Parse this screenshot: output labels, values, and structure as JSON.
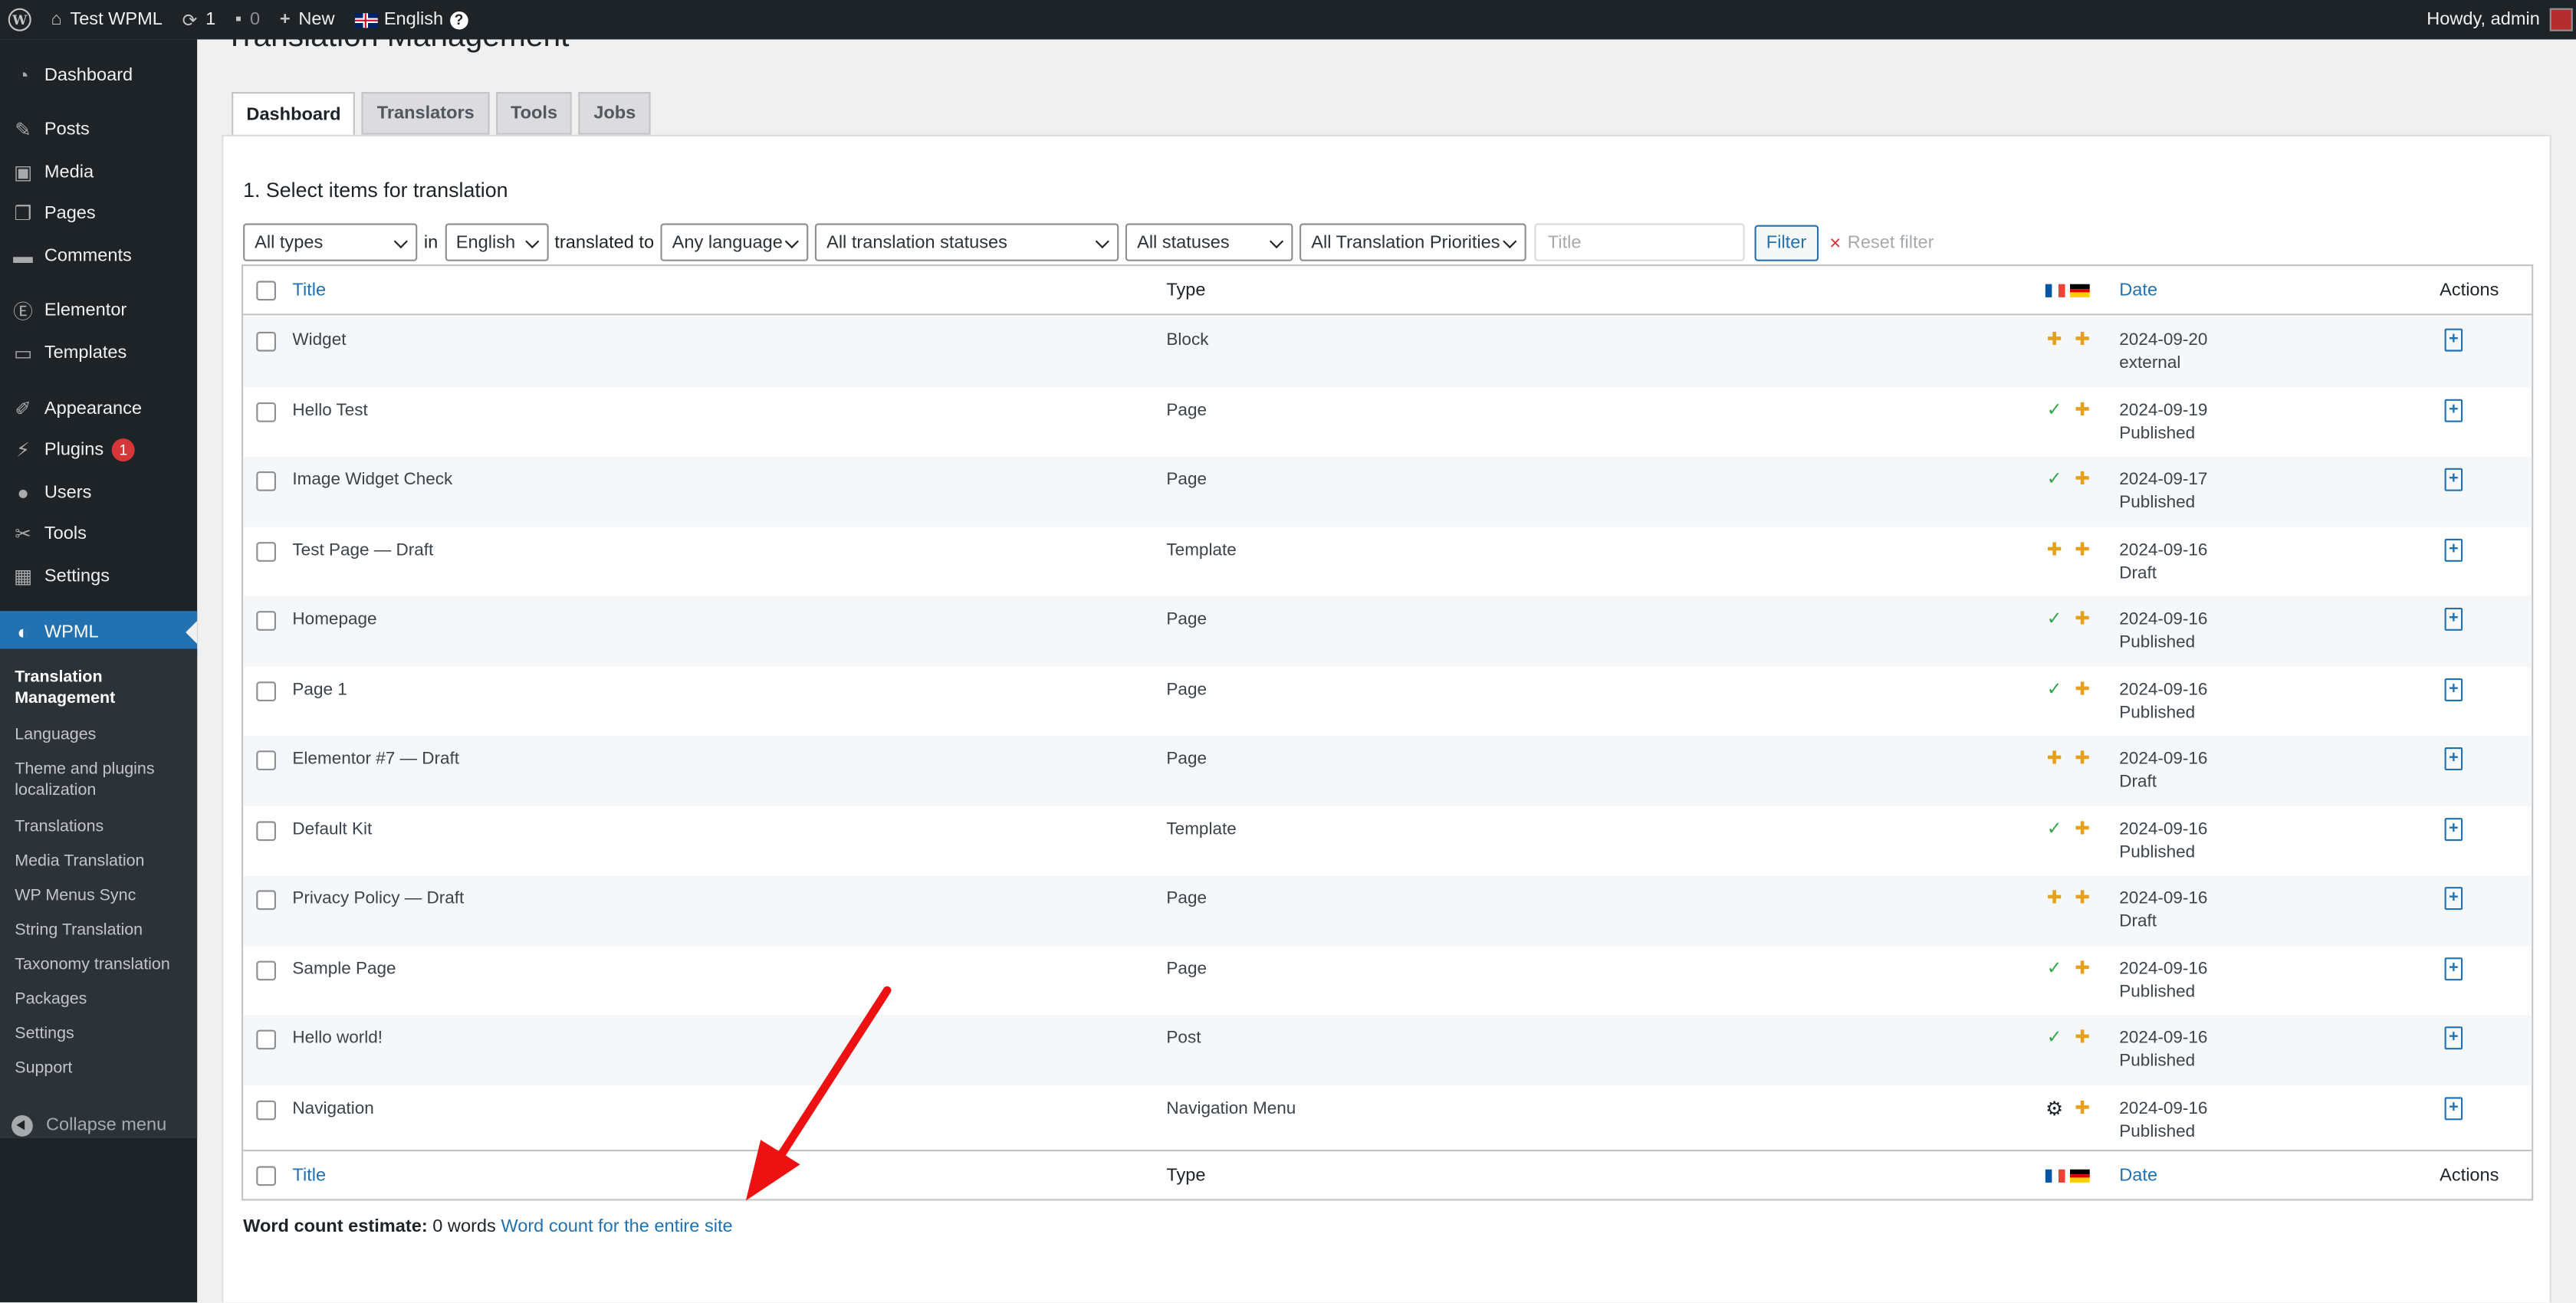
{
  "adminbar": {
    "site_name": "Test WPML",
    "updates_count": "1",
    "comments_count": "0",
    "new_label": "New",
    "language": "English",
    "howdy": "Howdy, admin"
  },
  "menu": {
    "dashboard": "Dashboard",
    "posts": "Posts",
    "media": "Media",
    "pages": "Pages",
    "comments": "Comments",
    "elementor": "Elementor",
    "templates": "Templates",
    "appearance": "Appearance",
    "plugins": "Plugins",
    "plugins_badge": "1",
    "users": "Users",
    "tools": "Tools",
    "settings": "Settings",
    "wpml": "WPML",
    "collapse": "Collapse menu"
  },
  "submenu": {
    "items": [
      "Translation Management",
      "Languages",
      "Theme and plugins localization",
      "Translations",
      "Media Translation",
      "WP Menus Sync",
      "String Translation",
      "Taxonomy translation",
      "Packages",
      "Settings",
      "Support"
    ]
  },
  "page": {
    "heading": "Translation Management",
    "tabs": [
      "Dashboard",
      "Translators",
      "Tools",
      "Jobs"
    ],
    "section_title": "1. Select items for translation"
  },
  "filters": {
    "type": "All types",
    "in_label": "in",
    "source_lang": "English",
    "translated_to_label": "translated to",
    "target_lang": "Any language",
    "translation_status": "All translation statuses",
    "status": "All statuses",
    "priority": "All Translation Priorities",
    "title_placeholder": "Title",
    "filter_button": "Filter",
    "reset_label": "Reset filter"
  },
  "table": {
    "columns": {
      "title": "Title",
      "type": "Type",
      "date": "Date",
      "actions": "Actions"
    },
    "rows": [
      {
        "title": "Widget",
        "type": "Block",
        "date": "2024-09-20",
        "status": "external",
        "fr": "orange",
        "de": "orange"
      },
      {
        "title": "Hello Test",
        "type": "Page",
        "date": "2024-09-19",
        "status": "Published",
        "fr": "green",
        "de": "orange"
      },
      {
        "title": "Image Widget Check",
        "type": "Page",
        "date": "2024-09-17",
        "status": "Published",
        "fr": "green",
        "de": "orange"
      },
      {
        "title": "Test Page — Draft",
        "type": "Template",
        "date": "2024-09-16",
        "status": "Draft",
        "fr": "orange",
        "de": "orange"
      },
      {
        "title": "Homepage",
        "type": "Page",
        "date": "2024-09-16",
        "status": "Published",
        "fr": "green",
        "de": "orange"
      },
      {
        "title": "Page 1",
        "type": "Page",
        "date": "2024-09-16",
        "status": "Published",
        "fr": "green",
        "de": "orange"
      },
      {
        "title": "Elementor #7 — Draft",
        "type": "Page",
        "date": "2024-09-16",
        "status": "Draft",
        "fr": "orange",
        "de": "orange"
      },
      {
        "title": "Default Kit",
        "type": "Template",
        "date": "2024-09-16",
        "status": "Published",
        "fr": "green",
        "de": "orange"
      },
      {
        "title": "Privacy Policy — Draft",
        "type": "Page",
        "date": "2024-09-16",
        "status": "Draft",
        "fr": "orange",
        "de": "orange"
      },
      {
        "title": "Sample Page",
        "type": "Page",
        "date": "2024-09-16",
        "status": "Published",
        "fr": "green",
        "de": "orange"
      },
      {
        "title": "Hello world!",
        "type": "Post",
        "date": "2024-09-16",
        "status": "Published",
        "fr": "green",
        "de": "orange"
      },
      {
        "title": "Navigation",
        "type": "Navigation Menu",
        "date": "2024-09-16",
        "status": "Published",
        "fr": "gear",
        "de": "orange"
      }
    ]
  },
  "wordcount": {
    "label": "Word count estimate:",
    "value": "0 words",
    "link": "Word count for the entire site"
  },
  "colors": {
    "accent": "#2271b1",
    "menu_bg": "#1d2327",
    "status_green": "#2ea84a",
    "status_orange": "#e6a11c",
    "annotation_arrow": "#ee1111"
  }
}
